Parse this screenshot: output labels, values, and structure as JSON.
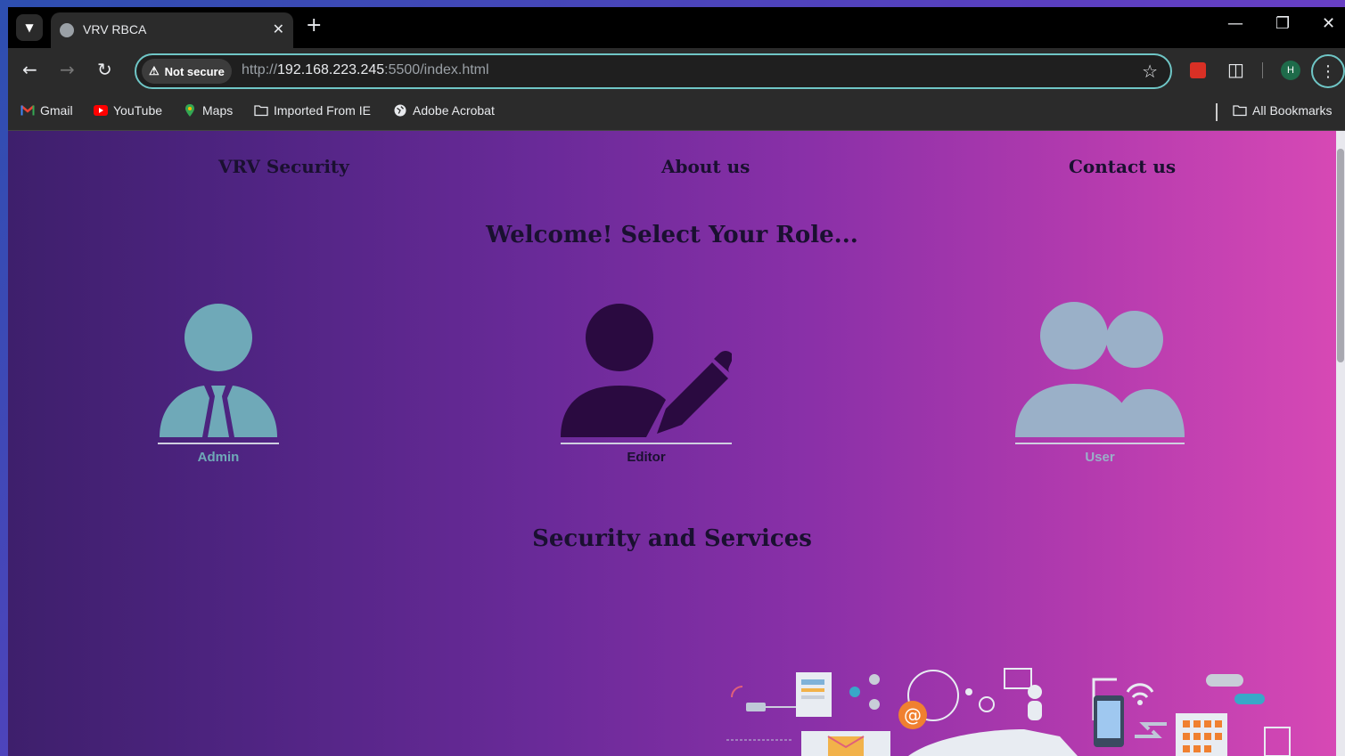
{
  "browser": {
    "tab_title": "VRV RBCA",
    "security_chip": "Not secure",
    "url_prefix": "http://",
    "url_host": "192.168.223.245",
    "url_suffix": ":5500/index.html",
    "profile_initial": "H",
    "bookmarks": [
      "Gmail",
      "YouTube",
      "Maps",
      "Imported From IE",
      "Adobe Acrobat"
    ],
    "all_bookmarks": "All Bookmarks"
  },
  "page": {
    "nav": [
      "VRV Security",
      "About us",
      "Contact us"
    ],
    "welcome": "Welcome! Select Your Role...",
    "roles": [
      {
        "label": "Admin",
        "color": "#6fa9b8"
      },
      {
        "label": "Editor",
        "color": "#2a0a40"
      },
      {
        "label": "User",
        "color": "#9ab0c8"
      }
    ],
    "services_heading": "Security and Services"
  }
}
